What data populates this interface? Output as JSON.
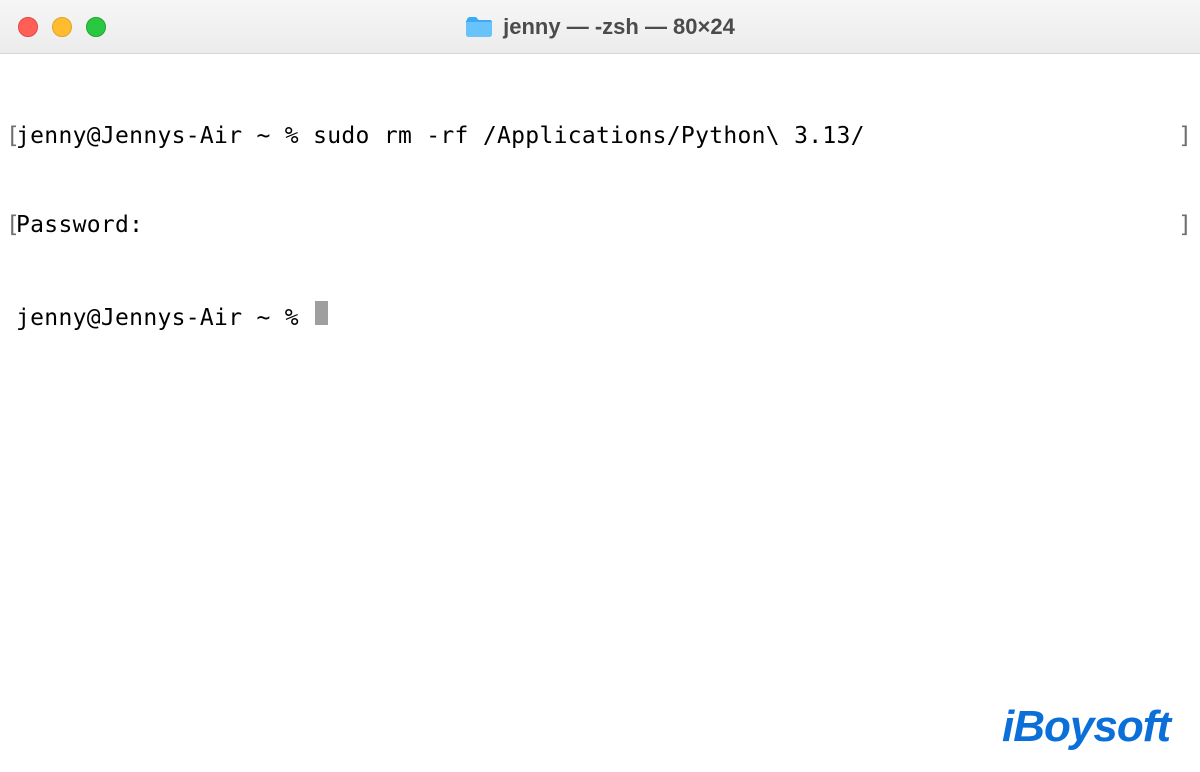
{
  "titlebar": {
    "title": "jenny — -zsh — 80×24"
  },
  "terminal": {
    "lines": [
      {
        "prefix": "[",
        "text": "jenny@Jennys-Air ~ % sudo rm -rf /Applications/Python\\ 3.13/",
        "suffix": "]"
      },
      {
        "prefix": "[",
        "text": "Password:",
        "suffix": "]"
      },
      {
        "prefix": " ",
        "text": "jenny@Jennys-Air ~ % ",
        "cursor": true
      }
    ]
  },
  "watermark": {
    "text": "iBoysoft"
  },
  "colors": {
    "close": "#ff5f57",
    "minimize": "#febc2e",
    "maximize": "#28c840",
    "brand": "#0a6fd8"
  }
}
